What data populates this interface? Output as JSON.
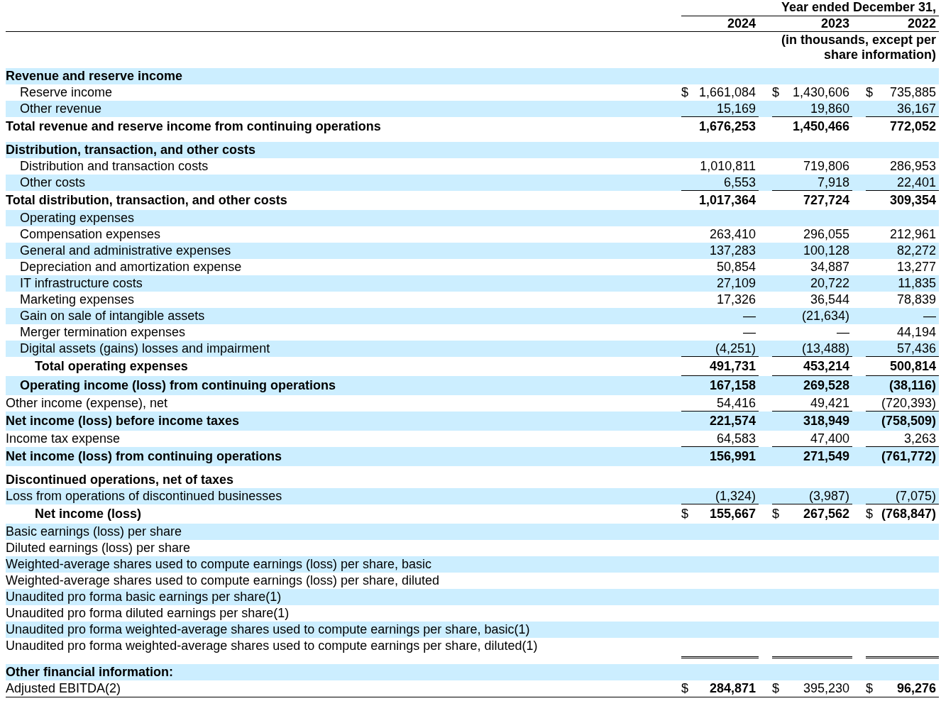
{
  "header": {
    "period_heading": "Year ended December 31,",
    "years": [
      "2024",
      "2023",
      "2022"
    ],
    "unit_note": "(in thousands, except per share information)"
  },
  "rows": [
    {
      "kind": "section",
      "label": "Revenue and reserve income",
      "shaded": true
    },
    {
      "kind": "item",
      "label": "Reserve income",
      "shaded": false,
      "cells": [
        {
          "currency": "$",
          "value": "1,661,084"
        },
        {
          "currency": "$",
          "value": "1,430,606"
        },
        {
          "currency": "$",
          "value": "735,885"
        }
      ]
    },
    {
      "kind": "item",
      "label": "Other revenue",
      "shaded": true,
      "underlined": true,
      "cells": [
        {
          "value": "15,169"
        },
        {
          "value": "19,860"
        },
        {
          "value": "36,167"
        }
      ]
    },
    {
      "kind": "total",
      "label": "Total revenue and reserve income from continuing operations",
      "shaded": false,
      "cells": [
        {
          "value": "1,676,253"
        },
        {
          "value": "1,450,466"
        },
        {
          "value": "772,052"
        }
      ]
    },
    {
      "kind": "section",
      "label": "Distribution, transaction, and other costs",
      "shaded": true,
      "gap_before": true
    },
    {
      "kind": "item",
      "label": "Distribution and transaction costs",
      "shaded": false,
      "cells": [
        {
          "value": "1,010,811"
        },
        {
          "value": "719,806"
        },
        {
          "value": "286,953"
        }
      ]
    },
    {
      "kind": "item",
      "label": "Other costs",
      "shaded": true,
      "underlined": true,
      "cells": [
        {
          "value": "6,553"
        },
        {
          "value": "7,918"
        },
        {
          "value": "22,401"
        }
      ]
    },
    {
      "kind": "total",
      "label": "Total distribution, transaction, and other costs",
      "shaded": false,
      "cells": [
        {
          "value": "1,017,364"
        },
        {
          "value": "727,724"
        },
        {
          "value": "309,354"
        }
      ]
    },
    {
      "kind": "item",
      "label": "Operating expenses",
      "shaded": true
    },
    {
      "kind": "item",
      "label": "Compensation expenses",
      "shaded": false,
      "cells": [
        {
          "value": "263,410"
        },
        {
          "value": "296,055"
        },
        {
          "value": "212,961"
        }
      ]
    },
    {
      "kind": "item",
      "label": "General and administrative expenses",
      "shaded": true,
      "cells": [
        {
          "value": "137,283"
        },
        {
          "value": "100,128"
        },
        {
          "value": "82,272"
        }
      ]
    },
    {
      "kind": "item",
      "label": "Depreciation and amortization expense",
      "shaded": false,
      "cells": [
        {
          "value": "50,854"
        },
        {
          "value": "34,887"
        },
        {
          "value": "13,277"
        }
      ]
    },
    {
      "kind": "item",
      "label": "IT infrastructure costs",
      "shaded": true,
      "cells": [
        {
          "value": "27,109"
        },
        {
          "value": "20,722"
        },
        {
          "value": "11,835"
        }
      ]
    },
    {
      "kind": "item",
      "label": "Marketing expenses",
      "shaded": false,
      "cells": [
        {
          "value": "17,326"
        },
        {
          "value": "36,544"
        },
        {
          "value": "78,839"
        }
      ]
    },
    {
      "kind": "item",
      "label": "Gain on sale of intangible assets",
      "shaded": true,
      "cells": [
        {
          "value": "—"
        },
        {
          "value": "(21,634)"
        },
        {
          "value": "—"
        }
      ]
    },
    {
      "kind": "item",
      "label": "Merger termination expenses",
      "shaded": false,
      "cells": [
        {
          "value": "—"
        },
        {
          "value": "—"
        },
        {
          "value": "44,194"
        }
      ]
    },
    {
      "kind": "item",
      "label": "Digital assets (gains) losses and impairment",
      "shaded": true,
      "underlined": true,
      "cells": [
        {
          "value": "(4,251)"
        },
        {
          "value": "(13,488)"
        },
        {
          "value": "57,436"
        }
      ]
    },
    {
      "kind": "subtotal",
      "label": "Total operating expenses",
      "shaded": false,
      "underlined": true,
      "cells": [
        {
          "value": "491,731"
        },
        {
          "value": "453,214"
        },
        {
          "value": "500,814"
        }
      ]
    },
    {
      "kind": "bold_item",
      "label": "Operating income (loss) from continuing operations",
      "shaded": true,
      "cells": [
        {
          "value": "167,158"
        },
        {
          "value": "269,528"
        },
        {
          "value": "(38,116)"
        }
      ]
    },
    {
      "kind": "plain",
      "label": "Other income (expense), net",
      "shaded": false,
      "underlined": true,
      "cells": [
        {
          "value": "54,416"
        },
        {
          "value": "49,421"
        },
        {
          "value": "(720,393)"
        }
      ]
    },
    {
      "kind": "total",
      "label": "Net income (loss) before income taxes",
      "shaded": true,
      "cells": [
        {
          "value": "221,574"
        },
        {
          "value": "318,949"
        },
        {
          "value": "(758,509)"
        }
      ]
    },
    {
      "kind": "plain",
      "label": "Income tax expense",
      "shaded": false,
      "underlined": true,
      "cells": [
        {
          "value": "64,583"
        },
        {
          "value": "47,400"
        },
        {
          "value": "3,263"
        }
      ]
    },
    {
      "kind": "total",
      "label": "Net income (loss) from continuing operations",
      "shaded": true,
      "cells": [
        {
          "value": "156,991"
        },
        {
          "value": "271,549"
        },
        {
          "value": "(761,772)"
        }
      ]
    },
    {
      "kind": "section",
      "label": "Discontinued operations, net of taxes",
      "shaded": false,
      "gap_before": true
    },
    {
      "kind": "plain",
      "label": "Loss from operations of discontinued businesses",
      "shaded": true,
      "underlined": true,
      "cells": [
        {
          "value": "(1,324)"
        },
        {
          "value": "(3,987)"
        },
        {
          "value": "(7,075)"
        }
      ]
    },
    {
      "kind": "subtotal",
      "label": "Net income (loss)",
      "shaded": false,
      "cells": [
        {
          "currency": "$",
          "value": "155,667"
        },
        {
          "currency": "$",
          "value": "267,562"
        },
        {
          "currency": "$",
          "value": "(768,847)"
        }
      ]
    },
    {
      "kind": "plain",
      "label": "Basic earnings (loss) per share",
      "shaded": true
    },
    {
      "kind": "plain",
      "label": "Diluted earnings (loss) per share",
      "shaded": false
    },
    {
      "kind": "plain",
      "label": "Weighted-average shares used to compute earnings (loss) per share, basic",
      "shaded": true
    },
    {
      "kind": "plain",
      "label": "Weighted-average shares used to compute earnings (loss) per share, diluted",
      "shaded": false
    },
    {
      "kind": "plain",
      "label": "Unaudited pro forma basic earnings per share(1)",
      "shaded": true
    },
    {
      "kind": "plain",
      "label": "Unaudited pro forma diluted earnings per share(1)",
      "shaded": false
    },
    {
      "kind": "plain",
      "label": "Unaudited pro forma weighted-average shares used to compute earnings per share, basic(1)",
      "shaded": true
    },
    {
      "kind": "plain",
      "label": "Unaudited pro forma weighted-average shares used to compute earnings per share, diluted(1)",
      "shaded": false,
      "double_rule_below": true
    },
    {
      "kind": "section",
      "label": "Other financial information:",
      "shaded": true
    },
    {
      "kind": "plain",
      "label": "Adjusted EBITDA(2)",
      "shaded": false,
      "cells": [
        {
          "currency": "$",
          "value": "284,871",
          "bold": true
        },
        {
          "currency": "$",
          "value": "395,230",
          "bold": false
        },
        {
          "currency": "$",
          "value": "96,276",
          "bold": true
        }
      ]
    }
  ]
}
